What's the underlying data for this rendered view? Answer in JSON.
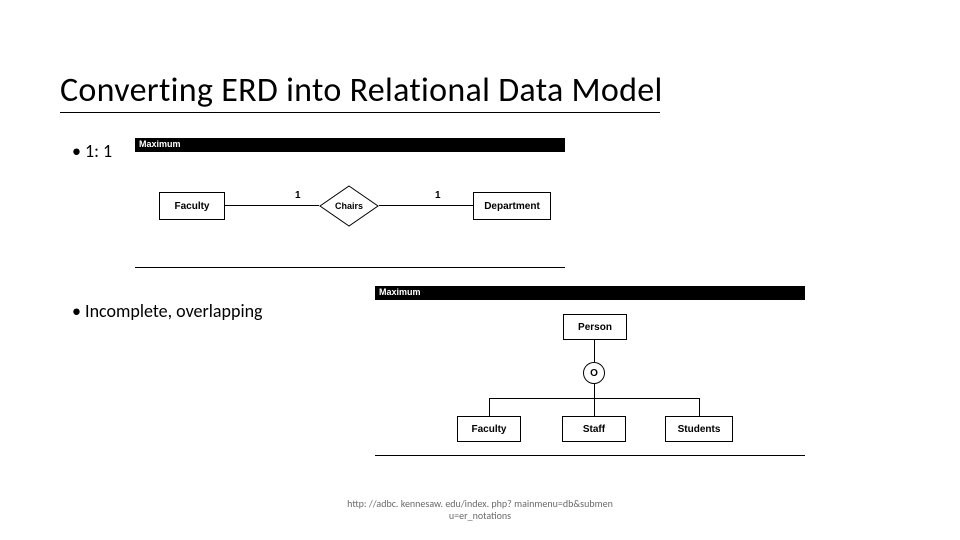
{
  "title": "Converting ERD into Relational Data Model",
  "bullets": {
    "b1": "1: 1",
    "b2": "Incomplete, overlapping"
  },
  "diagram1": {
    "header": "Maximum",
    "left_entity": "Faculty",
    "right_entity": "Department",
    "relationship": "Chairs",
    "left_card": "1",
    "right_card": "1"
  },
  "diagram2": {
    "header": "Maximum",
    "super_entity": "Person",
    "constraint_letter": "O",
    "sub1": "Faculty",
    "sub2": "Staff",
    "sub3": "Students"
  },
  "footer": {
    "line1": "http: //adbc. kennesaw. edu/index. php? mainmenu=db&submen",
    "line2": "u=er_notations"
  }
}
